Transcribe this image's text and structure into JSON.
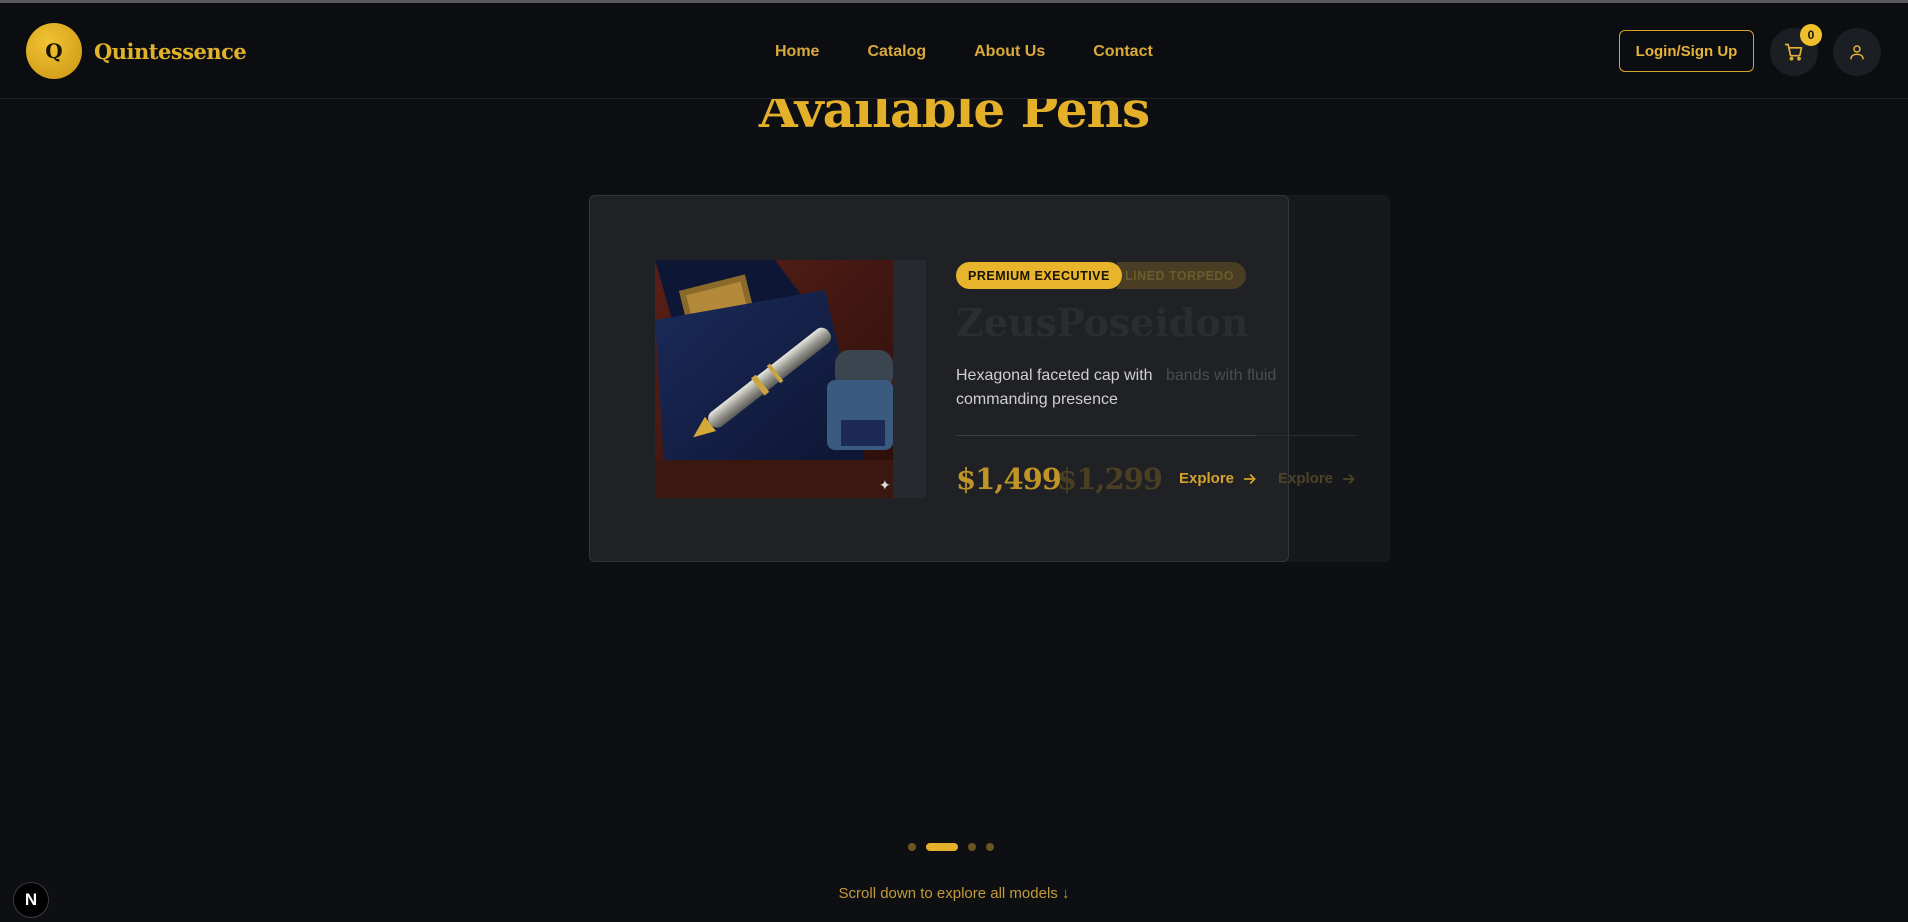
{
  "brand": {
    "logo_letter": "Q",
    "name": "Quintessence"
  },
  "nav": {
    "items": [
      {
        "label": "Home"
      },
      {
        "label": "Catalog"
      },
      {
        "label": "About Us"
      },
      {
        "label": "Contact"
      }
    ],
    "login_label": "Login/Sign Up",
    "cart_count": "0",
    "icons": [
      "cart-icon",
      "user-icon"
    ]
  },
  "section": {
    "title": "Available Pens"
  },
  "carousel": {
    "current": {
      "badge": "PREMIUM EXECUTIVE",
      "name": "Zeus",
      "description": "Hexagonal faceted cap with commanding presence",
      "price": "$1,499",
      "explore_label": "Explore"
    },
    "next": {
      "badge": "LINED TORPEDO",
      "name": "Poseidon",
      "description": "bands with fluid",
      "price": "$1,299",
      "explore_label": "Explore"
    },
    "dots_total": 4,
    "active_dot": 2
  },
  "scroll_hint": "Scroll down to explore all models ↓",
  "dev_badge": "N",
  "colors": {
    "accent": "#e5b12b",
    "background": "#0d0f13",
    "card": "#1f2124"
  }
}
